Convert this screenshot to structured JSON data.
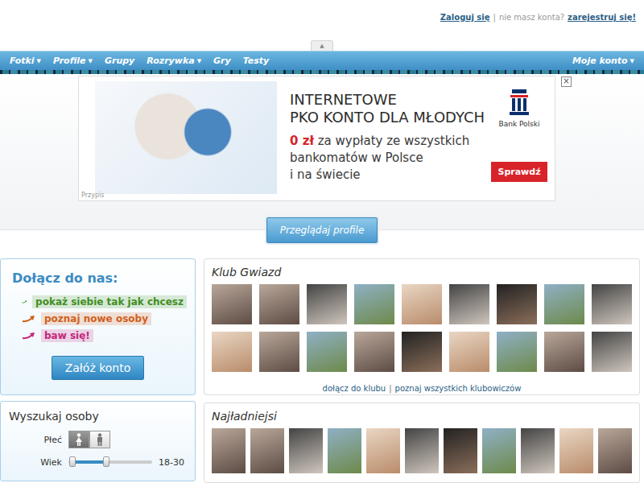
{
  "topbar": {
    "login": "Zaloguj się",
    "separator": "|",
    "prompt": "nie masz konta?",
    "register": "zarejestruj się!"
  },
  "toggle": {
    "icon": "▲"
  },
  "nav": {
    "items": [
      {
        "label": "Fotki",
        "caret": "▼"
      },
      {
        "label": "Profile",
        "caret": "▼"
      },
      {
        "label": "Grupy"
      },
      {
        "label": "Rozrywka",
        "caret": "▼"
      },
      {
        "label": "Gry"
      },
      {
        "label": "Testy"
      }
    ],
    "account": {
      "label": "Moje konto",
      "caret": "▼"
    }
  },
  "ad": {
    "headline": [
      "INTERNETOWE",
      "PKO KONTO DLA MŁODYCH"
    ],
    "highlight": "0 zł",
    "body_lines": [
      "za wypłaty ze wszystkich",
      "bankomatów w Polsce",
      "i na świecie"
    ],
    "brand": "Bank Polski",
    "button": "Sprawdź",
    "note": "Przypis",
    "close": "×"
  },
  "browse_button": "Przeglądaj profile",
  "join": {
    "title": "Dołącz do nas:",
    "items": [
      {
        "label": "pokaż siebie tak jak chcesz",
        "color": "#3f8f1f"
      },
      {
        "label": "poznaj nowe osoby",
        "color": "#d0601c"
      },
      {
        "label": "baw się!",
        "color": "#c2267a"
      }
    ],
    "button": "Załóż konto"
  },
  "search": {
    "title": "Wyszukaj osoby",
    "gender_label": "Płeć",
    "gender_options": [
      {
        "kind": "female",
        "selected": true
      },
      {
        "kind": "male",
        "selected": false
      }
    ],
    "age_label": "Wiek",
    "age_low": 0.05,
    "age_high": 0.45,
    "age_reading": "18-30"
  },
  "club": {
    "title": "Klub Gwiazd",
    "photos": [
      {
        "kind": "photo"
      },
      {
        "kind": "photo"
      },
      {
        "kind": "photo"
      },
      {
        "kind": "photo"
      },
      {
        "kind": "photo"
      },
      {
        "kind": "photo"
      },
      {
        "kind": "photo"
      },
      {
        "kind": "photo"
      },
      {
        "kind": "photo"
      },
      {
        "kind": "photo"
      },
      {
        "kind": "photo"
      },
      {
        "kind": "photo"
      },
      {
        "kind": "photo"
      },
      {
        "kind": "photo"
      },
      {
        "kind": "photo"
      },
      {
        "kind": "photo"
      },
      {
        "kind": "photo"
      },
      {
        "kind": "photo"
      }
    ],
    "links": [
      "dołącz do klubu",
      "poznaj wszystkich klubowiczów"
    ],
    "link_separator": "|"
  },
  "prettiest": {
    "title": "Najładniejsi",
    "photos": [
      {
        "kind": "photo"
      },
      {
        "kind": "photo"
      },
      {
        "kind": "photo"
      },
      {
        "kind": "photo"
      },
      {
        "kind": "photo"
      },
      {
        "kind": "photo"
      },
      {
        "kind": "photo"
      },
      {
        "kind": "photo"
      },
      {
        "kind": "photo"
      },
      {
        "kind": "photo"
      },
      {
        "kind": "photo"
      }
    ]
  }
}
